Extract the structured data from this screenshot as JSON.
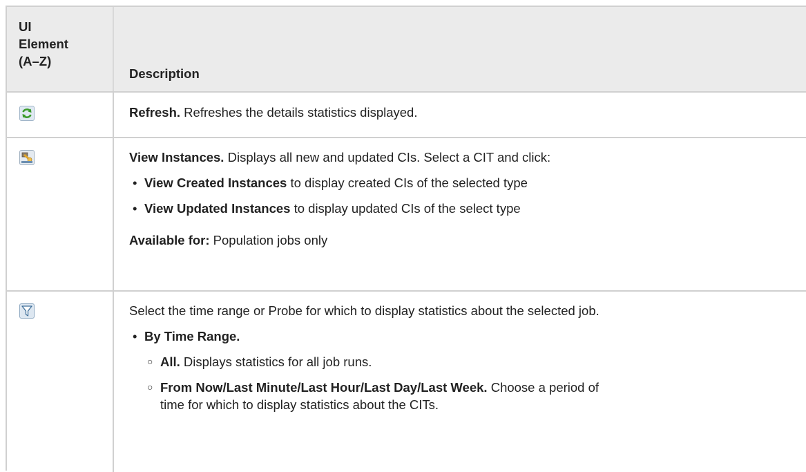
{
  "header": {
    "col1_line1": "UI",
    "col1_line2": "Element",
    "col1_line3": "(A–Z)",
    "col2": "Description"
  },
  "rows": [
    {
      "icon": "refresh-icon",
      "term": "Refresh.",
      "text": " Refreshes the details statistics displayed."
    },
    {
      "icon": "view-instances-icon",
      "term": "View Instances.",
      "text": " Displays all new and updated CIs. Select a CIT and click:",
      "bullets": [
        {
          "term": "View Created Instances",
          "text": " to display created CIs of the selected type"
        },
        {
          "term": "View Updated Instances",
          "text": " to display updated CIs of the select type"
        }
      ],
      "note_term": "Available for:",
      "note_text": " Population jobs only"
    },
    {
      "icon": "filter-icon",
      "text": "Select the time range or Probe for which to display statistics about the selected job.",
      "bullet_term": "By Time Range.",
      "sub": [
        {
          "term": "All.",
          "text": " Displays statistics for all job runs."
        },
        {
          "term": "From Now/Last Minute/Last Hour/Last Day/Last Week.",
          "text": " Choose a period of",
          "text2": "time for which to display statistics about the CITs."
        }
      ]
    }
  ]
}
